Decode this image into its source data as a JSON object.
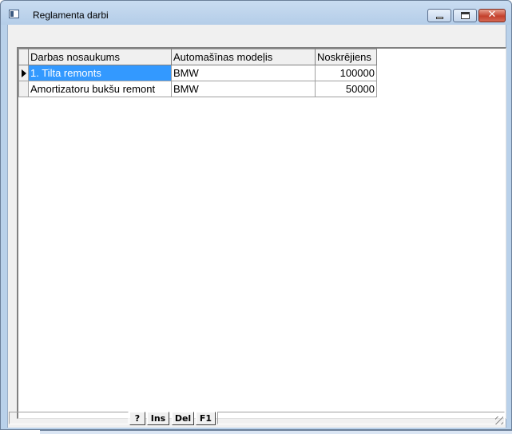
{
  "window": {
    "title": "Reglamenta darbi",
    "close_glyph": "✕"
  },
  "grid": {
    "columns": [
      "Darbas nosaukums",
      "Automašīnas modeļis",
      "Noskrējiens"
    ],
    "rows": [
      [
        "1. Tilta remonts",
        "BMW",
        "100000"
      ],
      [
        "Amortizatoru bukšu remont",
        "BMW",
        "50000"
      ]
    ],
    "selected_row": 0
  },
  "statusbar": {
    "keys": [
      "?",
      "Ins",
      "Del",
      "F1"
    ]
  },
  "colors": {
    "selection": "#3399ff",
    "title_bar": "#b9d1ea",
    "close_button": "#c4402c"
  },
  "icons": {
    "app": "window-icon",
    "minimize": "minimize-icon",
    "maximize": "maximize-icon",
    "close": "close-icon",
    "row_indicator": "triangle-right-icon",
    "resize": "resize-grip-icon"
  }
}
